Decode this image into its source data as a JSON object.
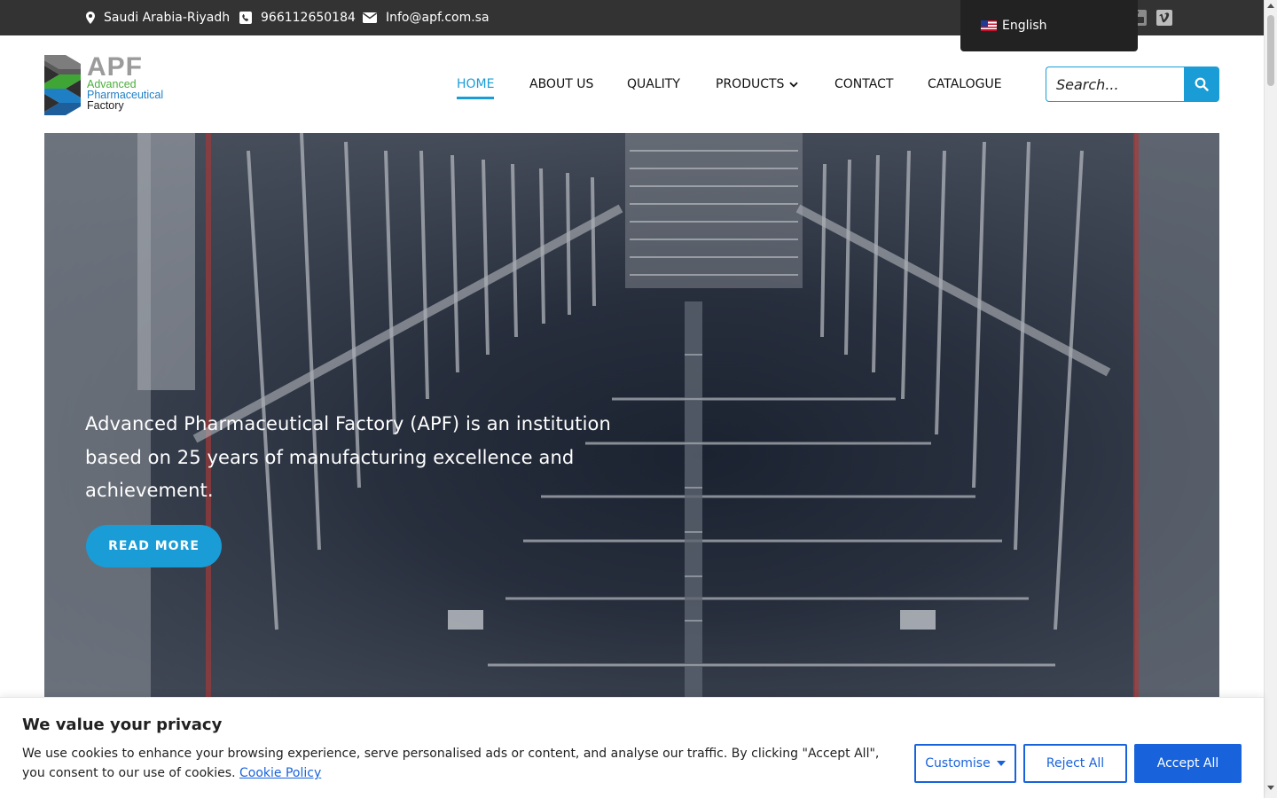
{
  "topbar": {
    "location": "Saudi Arabia-Riyadh",
    "phone": "966112650184",
    "email": "Info@apf.com.sa",
    "location_icon": "map-marker-icon",
    "phone_icon": "phone-icon",
    "email_icon": "envelope-icon",
    "social": [
      "youtube-icon",
      "vimeo-icon"
    ]
  },
  "language": {
    "label": "English",
    "flag": "us-flag-icon"
  },
  "logo": {
    "abbr": "APF",
    "line1": "Advanced",
    "line2": "Pharmaceutical",
    "line3": "Factory",
    "colors": {
      "gray": "#9b9b9b",
      "green": "#4cae3c",
      "blue": "#1f7fc5",
      "dark": "#222222"
    }
  },
  "nav": {
    "items": [
      {
        "label": "HOME",
        "active": true
      },
      {
        "label": "ABOUT US"
      },
      {
        "label": "QUALITY"
      },
      {
        "label": "PRODUCTS",
        "has_dropdown": true
      },
      {
        "label": "CONTACT"
      },
      {
        "label": "CATALOGUE"
      }
    ]
  },
  "search": {
    "placeholder": "Search..."
  },
  "hero": {
    "text": "Advanced Pharmaceutical Factory (APF) is an institution based on 25 years of manufacturing excellence and achievement.",
    "button": "READ MORE"
  },
  "cookie": {
    "title": "We value your privacy",
    "text": "We use cookies to enhance your browsing experience, serve personalised ads or content, and analyse our traffic. By clicking \"Accept All\", you consent to our use of cookies.",
    "link": "Cookie Policy",
    "customise": "Customise",
    "reject": "Reject All",
    "accept": "Accept All"
  },
  "colors": {
    "accent": "#1a9dd6",
    "topbar_bg": "#333333",
    "cookie_blue": "#1863dc"
  }
}
